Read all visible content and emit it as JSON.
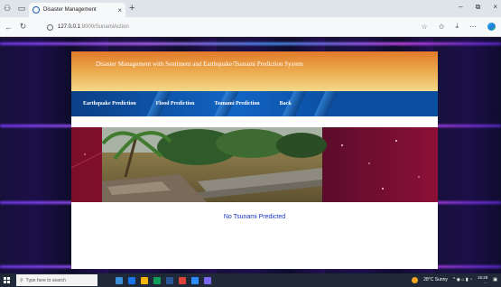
{
  "browser": {
    "tab_title": "Disaster Management",
    "tab_close": "×",
    "new_tab": "+",
    "url_host": "127.0.0.1",
    "url_path": ":8000/SunamiAction",
    "window_controls": [
      "–",
      "⧉",
      "×"
    ],
    "icons": [
      "back-icon",
      "refresh-icon",
      "info-icon",
      "star-icon",
      "favorites-icon",
      "download-icon",
      "more-icon",
      "edge-icon"
    ]
  },
  "page": {
    "header_title": "Disaster Management with Sentiment and Earthquake/Tsunami Prediction System",
    "menu": [
      {
        "label": "Earthquake Prediction"
      },
      {
        "label": "Flood Prediction"
      },
      {
        "label": "Tsunami Prediction"
      },
      {
        "label": "Back"
      }
    ],
    "result_text": "No Tsunami Predicted"
  },
  "taskbar": {
    "search_placeholder": "Type here to search",
    "weather": "28°C Sunny",
    "clock_time": "15:28",
    "clock_date": "…"
  },
  "colors": {
    "header_start": "#e07a2a",
    "header_end": "#f3d98a",
    "menu": "#0b4fa3",
    "result": "#1a35c8"
  }
}
